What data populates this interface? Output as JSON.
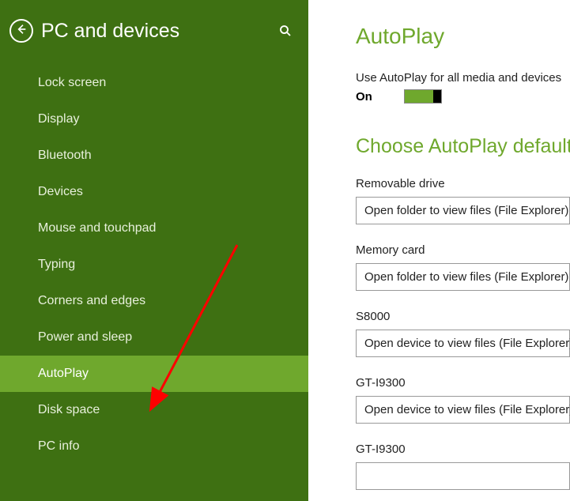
{
  "sidebar": {
    "title": "PC and devices",
    "items": [
      {
        "label": "Lock screen",
        "selected": false
      },
      {
        "label": "Display",
        "selected": false
      },
      {
        "label": "Bluetooth",
        "selected": false
      },
      {
        "label": "Devices",
        "selected": false
      },
      {
        "label": "Mouse and touchpad",
        "selected": false
      },
      {
        "label": "Typing",
        "selected": false
      },
      {
        "label": "Corners and edges",
        "selected": false
      },
      {
        "label": "Power and sleep",
        "selected": false
      },
      {
        "label": "AutoPlay",
        "selected": true
      },
      {
        "label": "Disk space",
        "selected": false
      },
      {
        "label": "PC info",
        "selected": false
      }
    ]
  },
  "content": {
    "title": "AutoPlay",
    "toggle": {
      "label": "Use AutoPlay for all media and devices",
      "state": "On"
    },
    "section_title": "Choose AutoPlay defaults",
    "devices": [
      {
        "label": "Removable drive",
        "value": "Open folder to view files (File Explorer)"
      },
      {
        "label": "Memory card",
        "value": "Open folder to view files (File Explorer)"
      },
      {
        "label": "S8000",
        "value": "Open device to view files (File Explorer)"
      },
      {
        "label": "GT-I9300",
        "value": "Open device to view files (File Explorer)"
      },
      {
        "label": "GT-I9300",
        "value": ""
      }
    ]
  },
  "colors": {
    "sidebar_bg": "#3e7012",
    "accent": "#6fa82d"
  }
}
